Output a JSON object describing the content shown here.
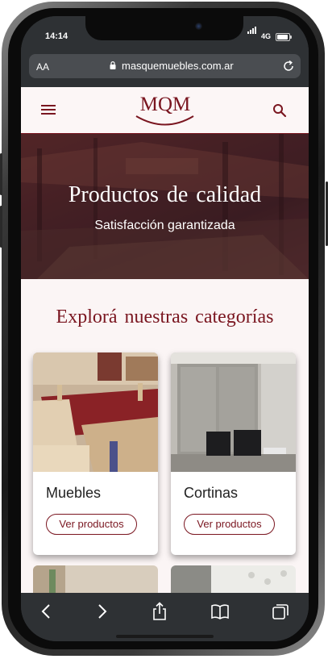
{
  "status_bar": {
    "time": "14:14",
    "network": "4G"
  },
  "browser": {
    "text_size_label": "AA",
    "url": "masquemuebles.com.ar"
  },
  "site": {
    "logo_text": "MQM",
    "hero": {
      "title": "Productos de calidad",
      "subtitle": "Satisfacción garantizada"
    },
    "categories_title": "Explorá nuestras categorías",
    "categories": [
      {
        "name": "Muebles",
        "button": "Ver productos"
      },
      {
        "name": "Cortinas",
        "button": "Ver productos"
      }
    ]
  },
  "colors": {
    "brand": "#7a1620",
    "background": "#fbf5f5",
    "browser_chrome": "#2e3134"
  },
  "icons": {
    "header": [
      "hamburger-menu-icon",
      "search-icon"
    ],
    "toolbar": [
      "back-icon",
      "forward-icon",
      "share-icon",
      "bookmarks-icon",
      "tabs-icon"
    ]
  }
}
